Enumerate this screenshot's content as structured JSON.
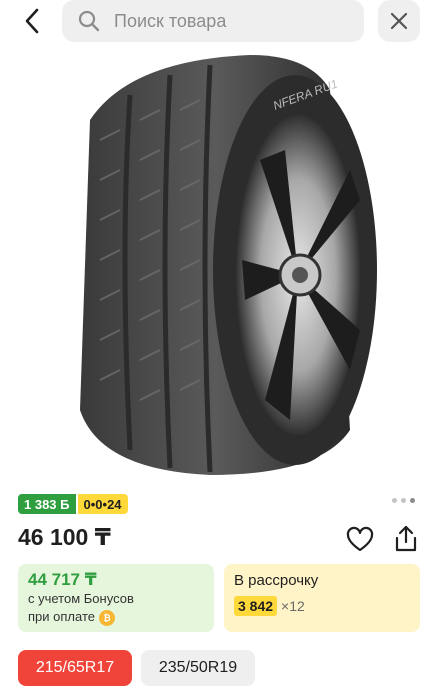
{
  "header": {
    "search_placeholder": "Поиск товара"
  },
  "product": {
    "image_alt": "NFERA RU1",
    "price": "46 100 ₸"
  },
  "badges": {
    "bonus": "1 383 Б",
    "installment": "0•0•24"
  },
  "gallery": {
    "dots": 3,
    "active_index": 2
  },
  "bonus_card": {
    "amount": "44 717 ₸",
    "line1": "с учетом Бонусов",
    "line2": "при оплате"
  },
  "installment_card": {
    "title": "В рассрочку",
    "monthly": "3 842",
    "months": "×12"
  },
  "sizes": {
    "selected": "215/65R17",
    "other": "235/50R19"
  },
  "colors": {
    "accent_red": "#f0443a",
    "bonus_green": "#2e9e3f",
    "installment_yellow": "#ffd83a"
  }
}
